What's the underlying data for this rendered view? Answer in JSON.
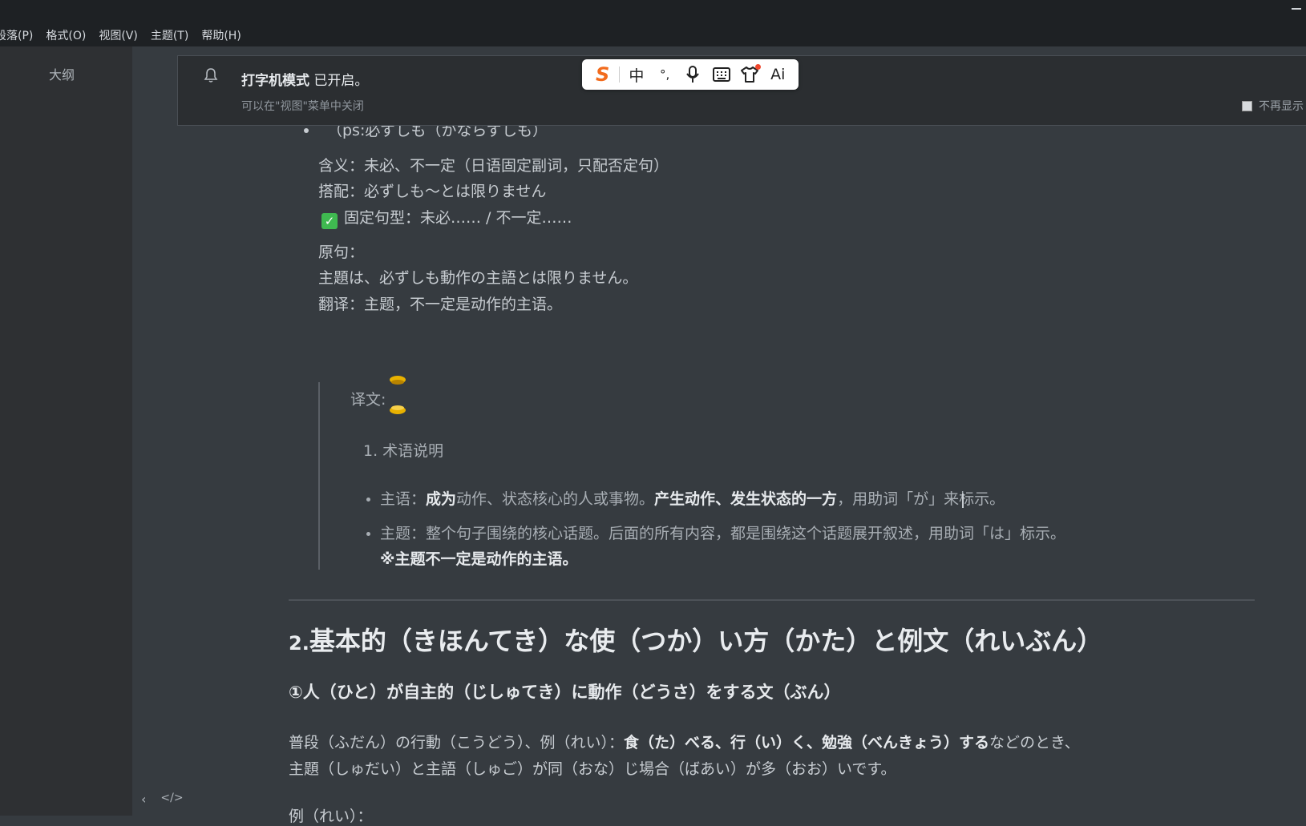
{
  "menu": [
    "段落(P)",
    "格式(O)",
    "视图(V)",
    "主题(T)",
    "帮助(H)"
  ],
  "sidebar": {
    "outline_label": "大纲"
  },
  "notification": {
    "title_bold": "打字机模式",
    "title_rest": " 已开启。",
    "subtitle": "可以在\"视图\"菜单中关闭",
    "dont_show": "不再显示"
  },
  "ime_toolbar": {
    "logo": "S",
    "items": [
      "中",
      "°,",
      "mic-icon",
      "keyboard-icon",
      "shirt-icon",
      "Ai"
    ]
  },
  "doc": {
    "partial_bullet": "（ps:必ずしも（かならずしも）",
    "meaning": "含义：未必、不一定（日语固定副词，只配否定句）",
    "collocation": "搭配：必ずしも～とは限りません",
    "pattern": "固定句型：未必…… / 不一定……",
    "orig_label": "原句：",
    "orig_sentence": "主題は、必ずしも動作の主語とは限りません。",
    "translation": "翻译：主题，不一定是动作的主语。",
    "quote": {
      "label": "译文:",
      "list_item_1": "1. 术语说明",
      "subject_label": "主语：",
      "subject_bold1": "成为",
      "subject_mid": "动作、状态核心的人或事物。",
      "subject_bold2": "产生动作、发生状态的一方",
      "subject_tail": "，用助词「が」来标示。",
      "topic_text": "主题：整个句子围绕的核心话题。后面的所有内容，都是围绕这个话题展开叙述，用助词「は」标示。",
      "topic_note": "※主题不一定是动作的主语。"
    },
    "h2_num": "2.",
    "h2_text": "基本的（きほんてき）な使（つか）い方（かた）と例文（れいぶん）",
    "h3": "①人（ひと）が自主的（じしゅてき）に動作（どうさ）をする文（ぶん）",
    "para1_a": "普段（ふだん）の行動（こうどう）、例（れい）：",
    "para1_bold": "食（た）べる、行（い）く、勉強（べんきょう）する",
    "para1_b": "などのとき、",
    "para2": "主題（しゅだい）と主語（しゅご）が同（おな）じ場合（ばあい）が多（おお）いです。",
    "cut_line": "例（れい）："
  },
  "bottom": {
    "back": "‹",
    "source": "</>"
  }
}
